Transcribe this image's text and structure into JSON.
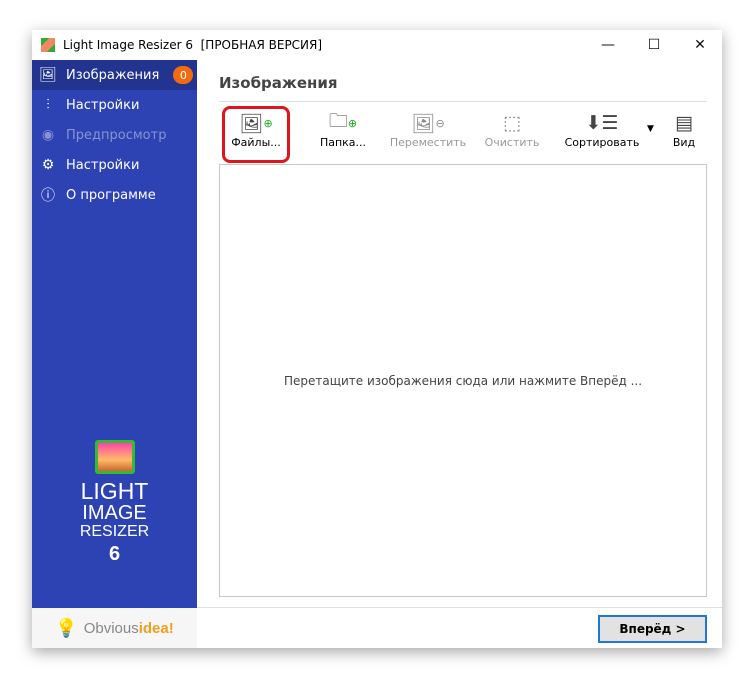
{
  "window": {
    "title": "Light Image Resizer 6  [ПРОБНАЯ ВЕРСИЯ]",
    "minimize": "—",
    "maximize": "☐",
    "close": "✕"
  },
  "sidebar": {
    "items": [
      {
        "label": "Изображения",
        "icon": "images-icon",
        "badge": "0",
        "state": "active"
      },
      {
        "label": "Настройки",
        "icon": "sliders-icon",
        "state": "normal"
      },
      {
        "label": "Предпросмотр",
        "icon": "eye-icon",
        "state": "disabled"
      },
      {
        "label": "Настройки",
        "icon": "gear-icon",
        "state": "normal"
      },
      {
        "label": "О программе",
        "icon": "info-icon",
        "state": "normal"
      }
    ],
    "logo": {
      "line1": "LIGHT",
      "line2": "IMAGE",
      "line3": "RESIZER",
      "line4": "6"
    },
    "brand": {
      "part1": "Obvious",
      "part2": "idea!"
    }
  },
  "main": {
    "heading": "Изображения",
    "toolbar": [
      {
        "label": "Файлы...",
        "icon": "add-image-icon"
      },
      {
        "label": "Папка...",
        "icon": "add-folder-icon"
      },
      {
        "label": "Переместить",
        "icon": "remove-image-icon",
        "disabled": true
      },
      {
        "label": "Очистить",
        "icon": "clear-icon",
        "disabled": true
      },
      {
        "label": "Сортировать",
        "icon": "sort-icon"
      },
      {
        "label": "Вид",
        "icon": "view-icon"
      }
    ],
    "drop_hint": "Перетащите изображения сюда или нажмите Вперёд ...",
    "next_button": "Вперёд >"
  },
  "colors": {
    "sidebar": "#2e43b3",
    "active": "#22348f",
    "badge": "#f26b0f",
    "highlight": "#e0141e",
    "accent": "#1e78d2"
  }
}
